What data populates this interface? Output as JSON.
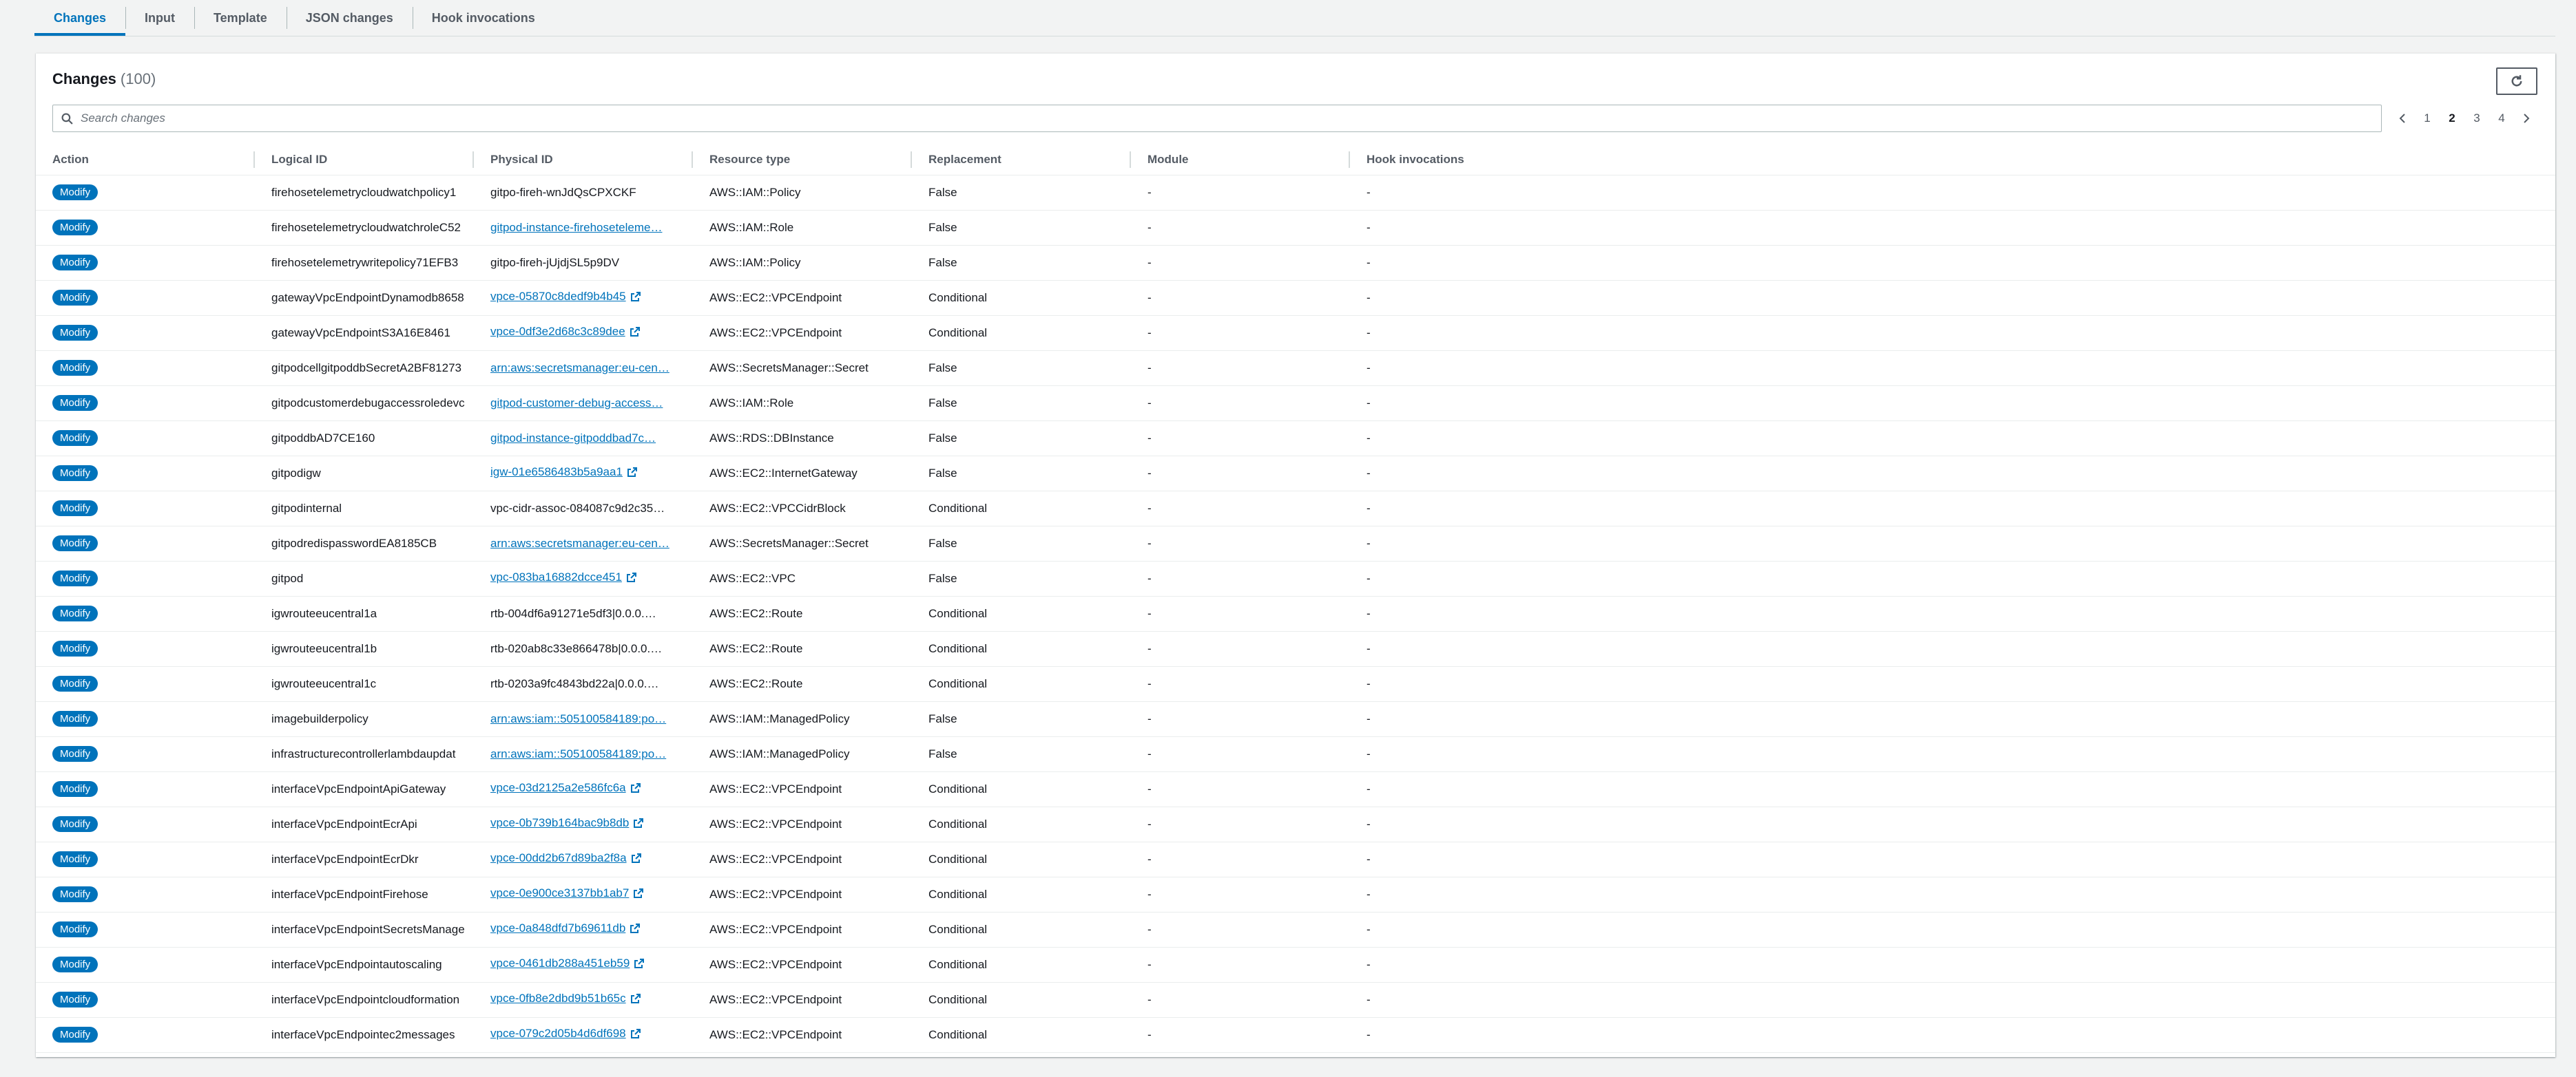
{
  "tabs": [
    {
      "label": "Changes",
      "active": true
    },
    {
      "label": "Input",
      "active": false
    },
    {
      "label": "Template",
      "active": false
    },
    {
      "label": "JSON changes",
      "active": false
    },
    {
      "label": "Hook invocations",
      "active": false
    }
  ],
  "panel": {
    "title": "Changes",
    "count": "(100)",
    "refresh_icon": "refresh-icon"
  },
  "search": {
    "placeholder": "Search changes",
    "value": ""
  },
  "pagination": {
    "prev_icon": "chevron-left-icon",
    "next_icon": "chevron-right-icon",
    "pages": [
      "1",
      "2",
      "3",
      "4"
    ],
    "current": "2"
  },
  "table": {
    "columns": [
      "Action",
      "Logical ID",
      "Physical ID",
      "Resource type",
      "Replacement",
      "Module",
      "Hook invocations"
    ],
    "rows": [
      {
        "action": "Modify",
        "logical": "firehosetelemetrycloudwatchpolicy1",
        "physical": "gitpo-fireh-wnJdQsCPXCKF",
        "link": false,
        "ext": false,
        "type": "AWS::IAM::Policy",
        "replacement": "False",
        "module": "-",
        "hook": "-"
      },
      {
        "action": "Modify",
        "logical": "firehosetelemetrycloudwatchroleC52",
        "physical": "gitpod-instance-firehoseteleme…",
        "link": true,
        "ext": false,
        "type": "AWS::IAM::Role",
        "replacement": "False",
        "module": "-",
        "hook": "-"
      },
      {
        "action": "Modify",
        "logical": "firehosetelemetrywritepolicy71EFB3",
        "physical": "gitpo-fireh-jUjdjSL5p9DV",
        "link": false,
        "ext": false,
        "type": "AWS::IAM::Policy",
        "replacement": "False",
        "module": "-",
        "hook": "-"
      },
      {
        "action": "Modify",
        "logical": "gatewayVpcEndpointDynamodb8658",
        "physical": "vpce-05870c8dedf9b4b45",
        "link": true,
        "ext": true,
        "type": "AWS::EC2::VPCEndpoint",
        "replacement": "Conditional",
        "module": "-",
        "hook": "-"
      },
      {
        "action": "Modify",
        "logical": "gatewayVpcEndpointS3A16E8461",
        "physical": "vpce-0df3e2d68c3c89dee",
        "link": true,
        "ext": true,
        "type": "AWS::EC2::VPCEndpoint",
        "replacement": "Conditional",
        "module": "-",
        "hook": "-"
      },
      {
        "action": "Modify",
        "logical": "gitpodcellgitpoddbSecretA2BF81273",
        "physical": "arn:aws:secretsmanager:eu-cen…",
        "link": true,
        "ext": false,
        "type": "AWS::SecretsManager::Secret",
        "replacement": "False",
        "module": "-",
        "hook": "-"
      },
      {
        "action": "Modify",
        "logical": "gitpodcustomerdebugaccessroledevc",
        "physical": "gitpod-customer-debug-access…",
        "link": true,
        "ext": false,
        "type": "AWS::IAM::Role",
        "replacement": "False",
        "module": "-",
        "hook": "-"
      },
      {
        "action": "Modify",
        "logical": "gitpoddbAD7CE160",
        "physical": "gitpod-instance-gitpoddbad7c…",
        "link": true,
        "ext": false,
        "type": "AWS::RDS::DBInstance",
        "replacement": "False",
        "module": "-",
        "hook": "-"
      },
      {
        "action": "Modify",
        "logical": "gitpodigw",
        "physical": "igw-01e6586483b5a9aa1",
        "link": true,
        "ext": true,
        "type": "AWS::EC2::InternetGateway",
        "replacement": "False",
        "module": "-",
        "hook": "-"
      },
      {
        "action": "Modify",
        "logical": "gitpodinternal",
        "physical": "vpc-cidr-assoc-084087c9d2c35…",
        "link": false,
        "ext": false,
        "type": "AWS::EC2::VPCCidrBlock",
        "replacement": "Conditional",
        "module": "-",
        "hook": "-"
      },
      {
        "action": "Modify",
        "logical": "gitpodredispasswordEA8185CB",
        "physical": "arn:aws:secretsmanager:eu-cen…",
        "link": true,
        "ext": false,
        "type": "AWS::SecretsManager::Secret",
        "replacement": "False",
        "module": "-",
        "hook": "-"
      },
      {
        "action": "Modify",
        "logical": "gitpod",
        "physical": "vpc-083ba16882dcce451",
        "link": true,
        "ext": true,
        "type": "AWS::EC2::VPC",
        "replacement": "False",
        "module": "-",
        "hook": "-"
      },
      {
        "action": "Modify",
        "logical": "igwrouteeucentral1a",
        "physical": "rtb-004df6a91271e5df3|0.0.0.…",
        "link": false,
        "ext": false,
        "type": "AWS::EC2::Route",
        "replacement": "Conditional",
        "module": "-",
        "hook": "-"
      },
      {
        "action": "Modify",
        "logical": "igwrouteeucentral1b",
        "physical": "rtb-020ab8c33e866478b|0.0.0.…",
        "link": false,
        "ext": false,
        "type": "AWS::EC2::Route",
        "replacement": "Conditional",
        "module": "-",
        "hook": "-"
      },
      {
        "action": "Modify",
        "logical": "igwrouteeucentral1c",
        "physical": "rtb-0203a9fc4843bd22a|0.0.0.…",
        "link": false,
        "ext": false,
        "type": "AWS::EC2::Route",
        "replacement": "Conditional",
        "module": "-",
        "hook": "-"
      },
      {
        "action": "Modify",
        "logical": "imagebuilderpolicy",
        "physical": "arn:aws:iam::505100584189:po…",
        "link": true,
        "ext": false,
        "type": "AWS::IAM::ManagedPolicy",
        "replacement": "False",
        "module": "-",
        "hook": "-"
      },
      {
        "action": "Modify",
        "logical": "infrastructurecontrollerlambdaupdat",
        "physical": "arn:aws:iam::505100584189:po…",
        "link": true,
        "ext": false,
        "type": "AWS::IAM::ManagedPolicy",
        "replacement": "False",
        "module": "-",
        "hook": "-"
      },
      {
        "action": "Modify",
        "logical": "interfaceVpcEndpointApiGateway",
        "physical": "vpce-03d2125a2e586fc6a",
        "link": true,
        "ext": true,
        "type": "AWS::EC2::VPCEndpoint",
        "replacement": "Conditional",
        "module": "-",
        "hook": "-"
      },
      {
        "action": "Modify",
        "logical": "interfaceVpcEndpointEcrApi",
        "physical": "vpce-0b739b164bac9b8db",
        "link": true,
        "ext": true,
        "type": "AWS::EC2::VPCEndpoint",
        "replacement": "Conditional",
        "module": "-",
        "hook": "-"
      },
      {
        "action": "Modify",
        "logical": "interfaceVpcEndpointEcrDkr",
        "physical": "vpce-00dd2b67d89ba2f8a",
        "link": true,
        "ext": true,
        "type": "AWS::EC2::VPCEndpoint",
        "replacement": "Conditional",
        "module": "-",
        "hook": "-"
      },
      {
        "action": "Modify",
        "logical": "interfaceVpcEndpointFirehose",
        "physical": "vpce-0e900ce3137bb1ab7",
        "link": true,
        "ext": true,
        "type": "AWS::EC2::VPCEndpoint",
        "replacement": "Conditional",
        "module": "-",
        "hook": "-"
      },
      {
        "action": "Modify",
        "logical": "interfaceVpcEndpointSecretsManage",
        "physical": "vpce-0a848dfd7b69611db",
        "link": true,
        "ext": true,
        "type": "AWS::EC2::VPCEndpoint",
        "replacement": "Conditional",
        "module": "-",
        "hook": "-"
      },
      {
        "action": "Modify",
        "logical": "interfaceVpcEndpointautoscaling",
        "physical": "vpce-0461db288a451eb59",
        "link": true,
        "ext": true,
        "type": "AWS::EC2::VPCEndpoint",
        "replacement": "Conditional",
        "module": "-",
        "hook": "-"
      },
      {
        "action": "Modify",
        "logical": "interfaceVpcEndpointcloudformation",
        "physical": "vpce-0fb8e2dbd9b51b65c",
        "link": true,
        "ext": true,
        "type": "AWS::EC2::VPCEndpoint",
        "replacement": "Conditional",
        "module": "-",
        "hook": "-"
      },
      {
        "action": "Modify",
        "logical": "interfaceVpcEndpointec2messages",
        "physical": "vpce-079c2d05b4d6df698",
        "link": true,
        "ext": true,
        "type": "AWS::EC2::VPCEndpoint",
        "replacement": "Conditional",
        "module": "-",
        "hook": "-"
      }
    ]
  },
  "colors": {
    "accent": "#0073bb",
    "badge_bg": "#0073bb",
    "page_bg": "#f2f3f3"
  }
}
